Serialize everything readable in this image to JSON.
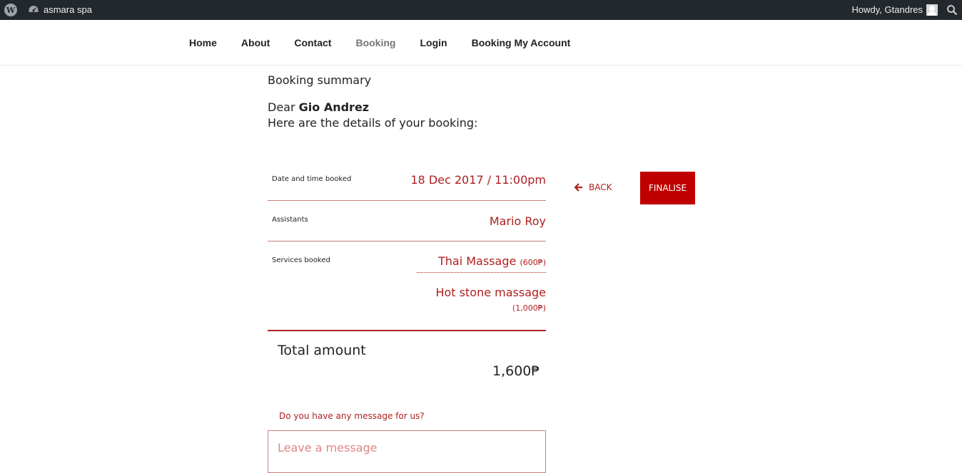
{
  "adminbar": {
    "site_name": "asmara spa",
    "howdy": "Howdy, Gtandres",
    "wp_logo_icon": "wordpress-logo-icon",
    "site_icon": "dashboard-icon",
    "search_icon": "search-icon"
  },
  "nav": {
    "items": [
      {
        "label": "Home"
      },
      {
        "label": "About"
      },
      {
        "label": "Contact"
      },
      {
        "label": "Booking",
        "current": true
      },
      {
        "label": "Login"
      },
      {
        "label": "Booking My Account"
      }
    ]
  },
  "summary": {
    "title": "Booking summary",
    "dear_prefix": "Dear",
    "customer_name": "Gio Andrez",
    "details_line": "Here are the details of your booking:"
  },
  "booking": {
    "date_label": "Date and time booked",
    "date_value": "18 Dec 2017 / 11:00pm",
    "assistants_label": "Assistants",
    "assistants_value": "Mario Roy",
    "services_label": "Services booked",
    "services": [
      {
        "name": "Thai Massage",
        "price": "(600₱)"
      },
      {
        "name": "Hot stone massage",
        "price": "(1,000₱)"
      }
    ],
    "total_label": "Total amount",
    "total_value": "1,600₱"
  },
  "message": {
    "label": "Do you have any message for us?",
    "placeholder": "Leave a message"
  },
  "actions": {
    "back_label": "BACK",
    "finalise_label": "FINALISE"
  },
  "colors": {
    "accent": "#c00000",
    "accent_text": "#b01e1e",
    "adminbar_bg": "#23282d"
  }
}
